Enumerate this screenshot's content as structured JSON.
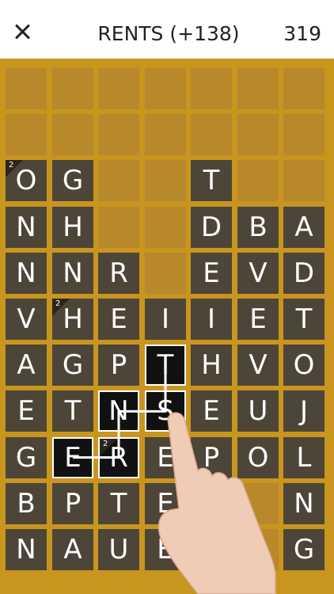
{
  "header": {
    "close_icon": "close-icon",
    "word": "RENTS (+138)",
    "score": "319"
  },
  "colors": {
    "board": "#c8951f",
    "tile": "#4d4538",
    "empty": "#b7892a",
    "selected": "#111111"
  },
  "board": {
    "rows": [
      [
        "",
        "",
        "",
        "",
        "",
        "",
        ""
      ],
      [
        "",
        "",
        "",
        "",
        "",
        "",
        ""
      ],
      [
        "O",
        "G",
        "",
        "",
        "T",
        "",
        ""
      ],
      [
        "N",
        "H",
        "",
        "",
        "D",
        "B",
        "A"
      ],
      [
        "N",
        "N",
        "R",
        "",
        "E",
        "V",
        "D"
      ],
      [
        "V",
        "H",
        "E",
        "I",
        "I",
        "E",
        "T"
      ],
      [
        "A",
        "G",
        "P",
        "T",
        "H",
        "V",
        "O"
      ],
      [
        "E",
        "T",
        "N",
        "S",
        "E",
        "U",
        "J"
      ],
      [
        "G",
        "E",
        "R",
        "E",
        "P",
        "O",
        "L"
      ],
      [
        "B",
        "P",
        "T",
        "E",
        "",
        "",
        "N"
      ],
      [
        "N",
        "A",
        "U",
        "E",
        "",
        "",
        "G"
      ]
    ],
    "multipliers": [
      {
        "row": 2,
        "col": 0,
        "label": "2"
      },
      {
        "row": 5,
        "col": 1,
        "label": "2"
      },
      {
        "row": 8,
        "col": 2,
        "label": "2"
      }
    ],
    "selected": [
      {
        "row": 8,
        "col": 1
      },
      {
        "row": 8,
        "col": 2
      },
      {
        "row": 7,
        "col": 2
      },
      {
        "row": 7,
        "col": 3
      },
      {
        "row": 6,
        "col": 3
      }
    ]
  },
  "hand_icon": "pointing-hand-icon"
}
